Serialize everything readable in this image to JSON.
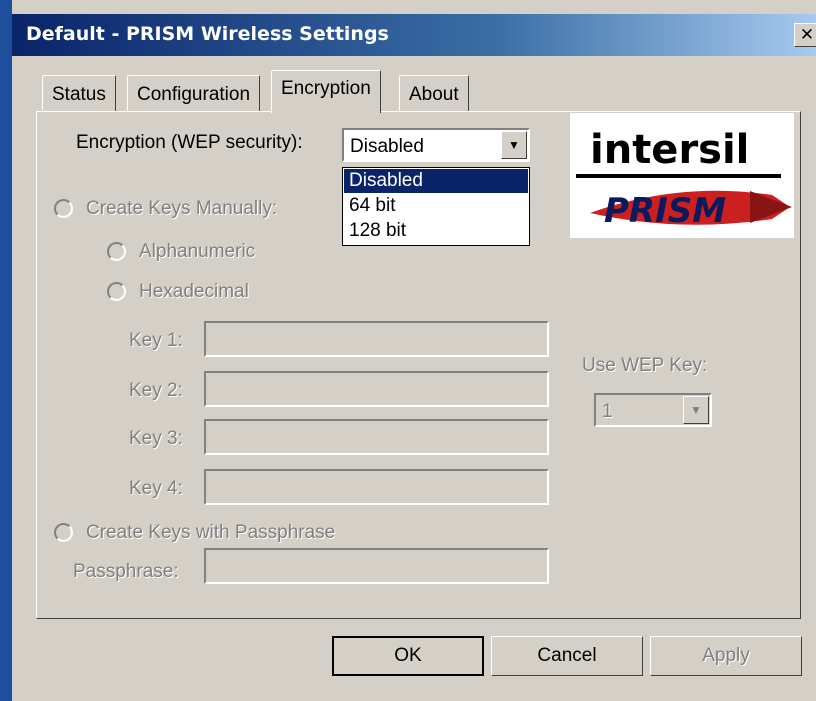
{
  "window": {
    "title": "Default - PRISM Wireless Settings",
    "close_glyph": "✕"
  },
  "tabs": [
    {
      "label": "Status"
    },
    {
      "label": "Configuration"
    },
    {
      "label": "Encryption",
      "active": true
    },
    {
      "label": "About"
    }
  ],
  "encryption": {
    "label": "Encryption (WEP security):",
    "selected": "Disabled",
    "options": [
      "Disabled",
      "64 bit",
      "128 bit"
    ]
  },
  "manual": {
    "label": "Create Keys Manually:",
    "alphanumeric": "Alphanumeric",
    "hexadecimal": "Hexadecimal"
  },
  "keys": [
    {
      "label": "Key 1:"
    },
    {
      "label": "Key 2:"
    },
    {
      "label": "Key 3:"
    },
    {
      "label": "Key 4:"
    }
  ],
  "use_wep_key": {
    "label": "Use WEP Key:",
    "value": "1"
  },
  "passphrase": {
    "radio_label": "Create Keys with Passphrase",
    "label": "Passphrase:"
  },
  "logo": {
    "brand": "intersil",
    "product": "PRISM"
  },
  "buttons": {
    "ok": "OK",
    "cancel": "Cancel",
    "apply": "Apply"
  },
  "colors": {
    "titlebar_start": "#0a246a",
    "selection": "#0a246a",
    "logo_red": "#cc1f1f"
  }
}
